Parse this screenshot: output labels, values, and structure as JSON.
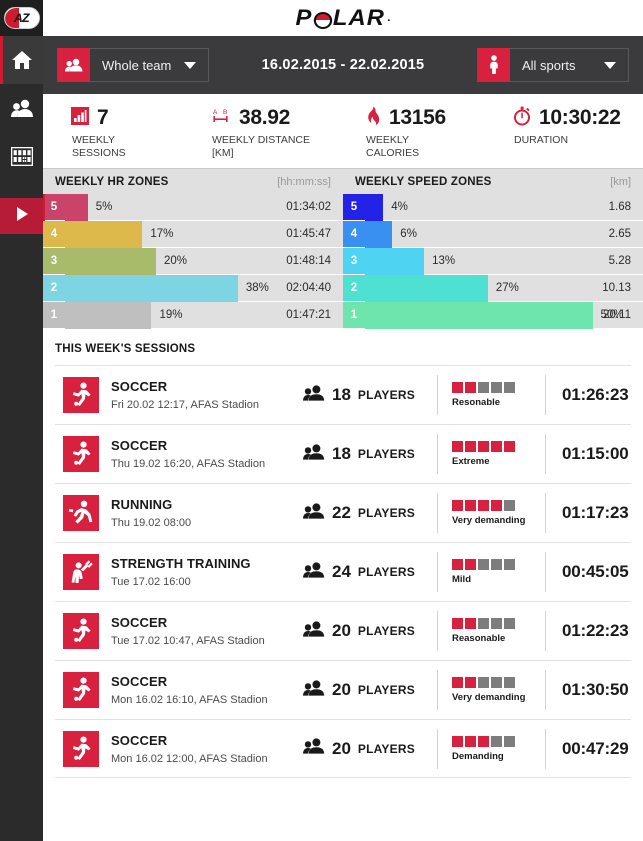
{
  "brand": {
    "logo_text": "POLAR",
    "trademark": "."
  },
  "sidebar": {
    "logo_label": "AZ",
    "items": [
      {
        "name": "home",
        "icon": "home-icon",
        "active": true
      },
      {
        "name": "team",
        "icon": "people-icon",
        "active": false
      },
      {
        "name": "calendar",
        "icon": "calendar-grid-icon",
        "active": false
      }
    ],
    "play_button": {
      "icon": "play-icon"
    }
  },
  "filterbar": {
    "team_dropdown": {
      "label": "Whole team",
      "icon": "people-icon"
    },
    "date_range": "16.02.2015 - 22.02.2015",
    "sports_dropdown": {
      "label": "All sports",
      "icon": "person-icon"
    }
  },
  "summary": {
    "stats": [
      {
        "icon": "bar-chart-icon",
        "value": "7",
        "label": "WEEKLY\nSESSIONS",
        "label_line1": "WEEKLY",
        "label_line2": "SESSIONS"
      },
      {
        "icon": "distance-icon",
        "value": "38.92",
        "label_line1": "WEEKLY DISTANCE",
        "label_line2": "[KM]"
      },
      {
        "icon": "flame-icon",
        "value": "13156",
        "label_line1": "WEEKLY",
        "label_line2": "CALORIES"
      },
      {
        "icon": "stopwatch-icon",
        "value": "10:30:22",
        "label_line1": "DURATION",
        "label_line2": ""
      }
    ]
  },
  "zones": {
    "hr": {
      "title": "WEEKLY HR ZONES",
      "unit": "[hh:mm:ss]",
      "rows": [
        {
          "zone": "5",
          "percent": "5%",
          "pct_num": 5,
          "value": "01:34:02",
          "color": "#c9436b"
        },
        {
          "zone": "4",
          "percent": "17%",
          "pct_num": 17,
          "value": "01:45:47",
          "color": "#dcb94a"
        },
        {
          "zone": "3",
          "percent": "20%",
          "pct_num": 20,
          "value": "01:48:14",
          "color": "#a8bb6a"
        },
        {
          "zone": "2",
          "percent": "38%",
          "pct_num": 38,
          "value": "02:04:40",
          "color": "#7fd4e3"
        },
        {
          "zone": "1",
          "percent": "19%",
          "pct_num": 19,
          "value": "01:47:21",
          "color": "#bfbfbf"
        }
      ]
    },
    "speed": {
      "title": "WEEKLY SPEED ZONES",
      "unit": "[km]",
      "rows": [
        {
          "zone": "5",
          "percent": "4%",
          "pct_num": 4,
          "value": "1.68",
          "color": "#2323e8"
        },
        {
          "zone": "4",
          "percent": "6%",
          "pct_num": 6,
          "value": "2.65",
          "color": "#3a90f0"
        },
        {
          "zone": "3",
          "percent": "13%",
          "pct_num": 13,
          "value": "5.28",
          "color": "#4ed3f2"
        },
        {
          "zone": "2",
          "percent": "27%",
          "pct_num": 27,
          "value": "10.13",
          "color": "#4ee0d0"
        },
        {
          "zone": "1",
          "percent": "50%",
          "pct_num": 50,
          "value": "20.11",
          "color": "#6ee5ad"
        }
      ]
    }
  },
  "sessions": {
    "title": "THIS WEEK'S SESSIONS",
    "players_label": "PLAYERS",
    "rows": [
      {
        "sport_icon": "soccer-icon",
        "name": "SOCCER",
        "sub": "Fri 20.02 12:17, AFAS Stadion",
        "players": "18",
        "load_dots": 2,
        "load_label": "Resonable",
        "duration": "01:26:23"
      },
      {
        "sport_icon": "soccer-icon",
        "name": "SOCCER",
        "sub": "Thu 19.02 16:20, AFAS Stadion",
        "players": "18",
        "load_dots": 5,
        "load_label": "Extreme",
        "duration": "01:15:00"
      },
      {
        "sport_icon": "running-icon",
        "name": "RUNNING",
        "sub": "Thu 19.02 08:00",
        "players": "22",
        "load_dots": 4,
        "load_label": "Very demanding",
        "duration": "01:17:23"
      },
      {
        "sport_icon": "strength-icon",
        "name": "STRENGTH TRAINING",
        "sub": "Tue 17.02 16:00",
        "players": "24",
        "load_dots": 2,
        "load_label": "Mild",
        "duration": "00:45:05"
      },
      {
        "sport_icon": "soccer-icon",
        "name": "SOCCER",
        "sub": "Tue 17.02 10:47, AFAS Stadion",
        "players": "20",
        "load_dots": 2,
        "load_label": "Reasonable",
        "duration": "01:22:23"
      },
      {
        "sport_icon": "soccer-icon",
        "name": "SOCCER",
        "sub": "Mon 16.02 16:10, AFAS Stadion",
        "players": "20",
        "load_dots": 2,
        "load_label": "Very demanding",
        "duration": "01:30:50"
      },
      {
        "sport_icon": "soccer-icon",
        "name": "SOCCER",
        "sub": "Mon 16.02 12:00, AFAS Stadion",
        "players": "20",
        "load_dots": 3,
        "load_label": "Demanding",
        "duration": "00:47:29"
      }
    ]
  },
  "colors": {
    "accent": "#d8213f",
    "dark": "#2b2b2b",
    "filterbar": "#3b3b3e",
    "zone_bg": "#e0e0e0"
  },
  "chart_data": {
    "type": "bar",
    "title": "Weekly HR Zones / Weekly Speed Zones",
    "charts": [
      {
        "name": "WEEKLY HR ZONES",
        "unit": "[hh:mm:ss]",
        "categories": [
          "5",
          "4",
          "3",
          "2",
          "1"
        ],
        "values": [
          5,
          17,
          20,
          38,
          19
        ],
        "labels": [
          "01:34:02",
          "01:45:47",
          "01:48:14",
          "02:04:40",
          "01:47:21"
        ],
        "ylabel": "percent"
      },
      {
        "name": "WEEKLY SPEED ZONES",
        "unit": "[km]",
        "categories": [
          "5",
          "4",
          "3",
          "2",
          "1"
        ],
        "values": [
          4,
          6,
          13,
          27,
          50
        ],
        "labels": [
          "1.68",
          "2.65",
          "5.28",
          "10.13",
          "20.11"
        ],
        "ylabel": "percent"
      }
    ]
  }
}
